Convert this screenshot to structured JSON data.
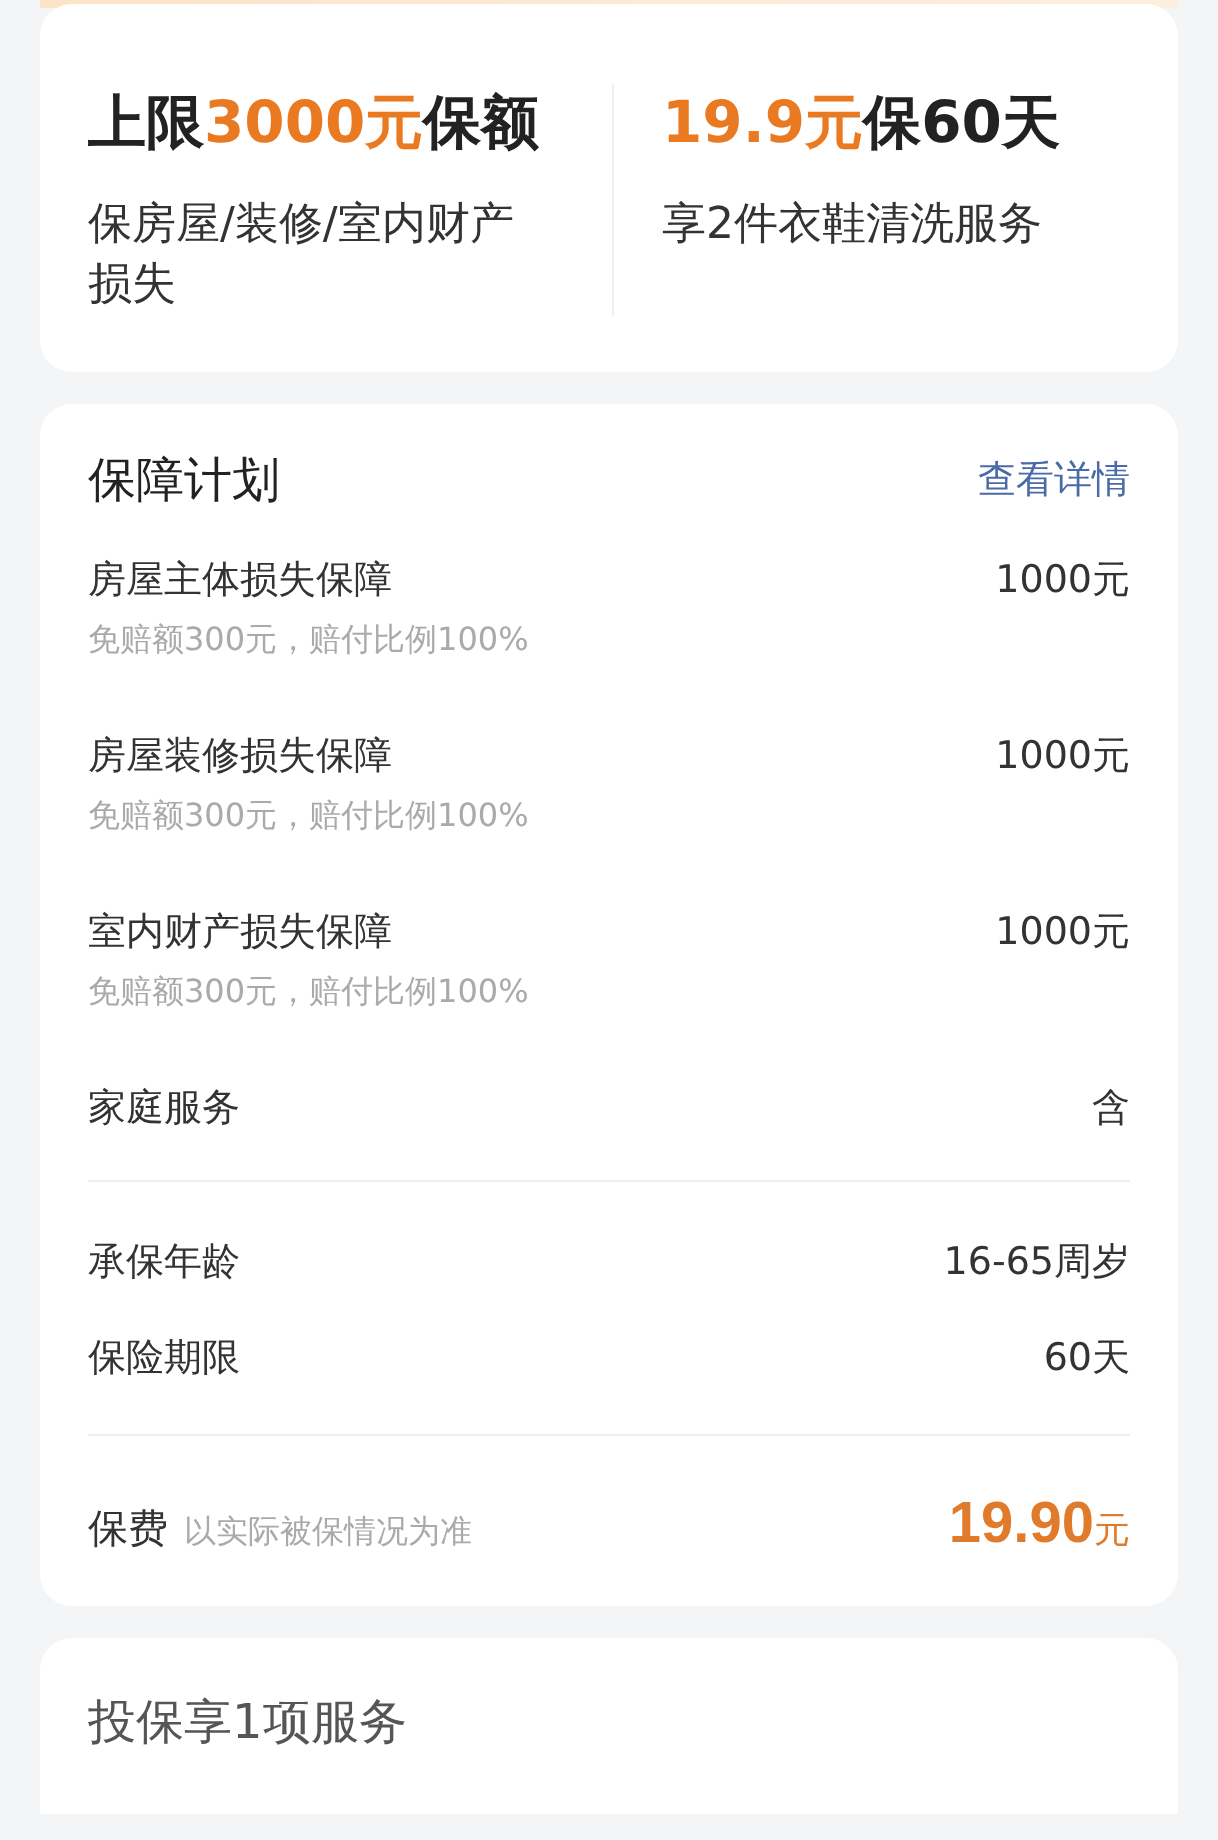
{
  "highlights": [
    {
      "headline": [
        {
          "text": "上限",
          "accent": false
        },
        {
          "text": "3000元",
          "accent": true
        },
        {
          "text": "保额",
          "accent": false
        }
      ],
      "description": "保房屋/装修/室内财产损失"
    },
    {
      "headline": [
        {
          "text": "19.9元",
          "accent": true
        },
        {
          "text": "保60天",
          "accent": false
        }
      ],
      "description": "享2件衣鞋清洗服务"
    }
  ],
  "plan": {
    "title": "保障计划",
    "details_link": "查看详情",
    "groups": [
      [
        {
          "name": "房屋主体损失保障",
          "value": "1000元",
          "note": "免赔额300元，赔付比例100%"
        },
        {
          "name": "房屋装修损失保障",
          "value": "1000元",
          "note": "免赔额300元，赔付比例100%"
        },
        {
          "name": "室内财产损失保障",
          "value": "1000元",
          "note": "免赔额300元，赔付比例100%"
        },
        {
          "name": "家庭服务",
          "value": "含"
        }
      ],
      [
        {
          "name": "承保年龄",
          "value": "16-65周岁"
        },
        {
          "name": "保险期限",
          "value": "60天"
        }
      ]
    ],
    "premium": {
      "label": "保费",
      "hint": "以实际被保情况为准",
      "amount": "19.90",
      "unit": "元"
    }
  },
  "services": {
    "title": "投保享1项服务"
  }
}
